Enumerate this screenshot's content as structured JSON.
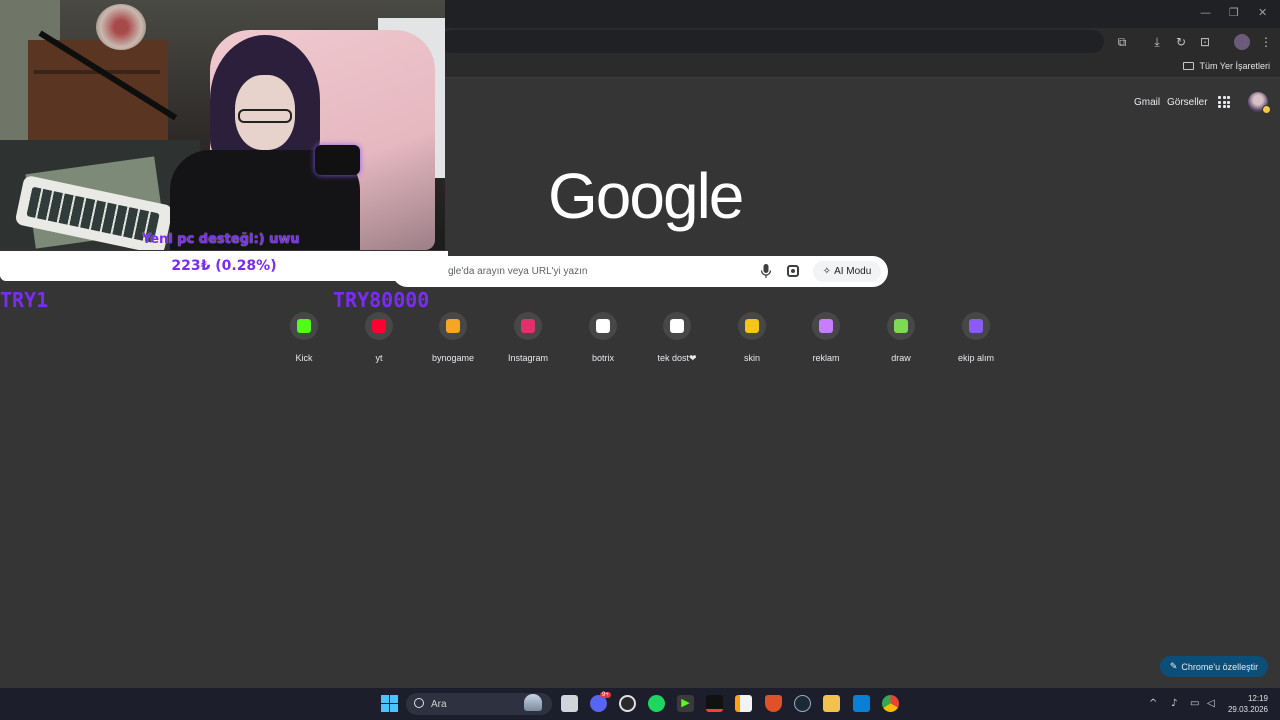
{
  "browser": {
    "bookmarks_bar": {
      "all_bookmarks_label": "Tüm Yer İşaretleri"
    }
  },
  "ntp": {
    "top_links": {
      "gmail": "Gmail",
      "images": "Görseller"
    },
    "logo_text": "Google",
    "search": {
      "placeholder": "gle'da arayın veya URL'yi yazın",
      "ai_mode_label": "AI Modu"
    },
    "shortcuts": [
      {
        "label": "Kick",
        "icon": "kick-icon",
        "color": "#53fc18"
      },
      {
        "label": "yt",
        "icon": "youtube-icon",
        "color": "#ff0033"
      },
      {
        "label": "bynogame",
        "icon": "bynogame-icon",
        "color": "#f5a623"
      },
      {
        "label": "Instagram",
        "icon": "instagram-icon",
        "color": "#e1306c"
      },
      {
        "label": "botrix",
        "icon": "botrix-icon",
        "color": "#ffffff"
      },
      {
        "label": "tek dost❤",
        "icon": "chatgpt-icon",
        "color": "#ffffff"
      },
      {
        "label": "skin",
        "icon": "skin-icon",
        "color": "#f5c518"
      },
      {
        "label": "reklam",
        "icon": "reklam-icon",
        "color": "#c77dff"
      },
      {
        "label": "draw",
        "icon": "draw-icon",
        "color": "#7ed957"
      },
      {
        "label": "ekip alım",
        "icon": "list-icon",
        "color": "#8a5cf5"
      }
    ],
    "customize_label": "Chrome'u özelleştir"
  },
  "overlay": {
    "donation_message": "Yeni pc desteği:) uwu",
    "donation_amount": "223₺ (0.28%)",
    "goal_start": "TRY1",
    "goal_end": "TRY80000"
  },
  "taskbar": {
    "search_label": "Ara",
    "discord_badge": "9+",
    "time": "12:19",
    "date": "29.03.2026"
  }
}
